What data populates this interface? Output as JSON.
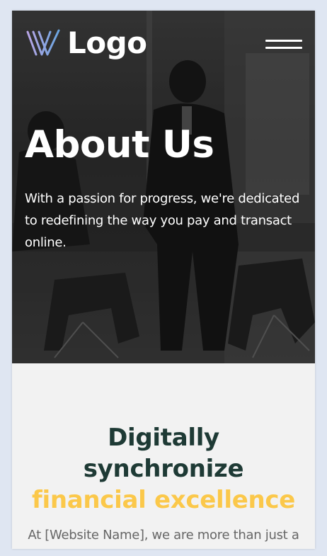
{
  "header": {
    "logo_text": "Logo",
    "logo_icon": "w-mark-icon",
    "menu_icon": "hamburger-menu-icon"
  },
  "hero": {
    "title": "About Us",
    "description": "With a passion for progress, we're dedicated to redefining the way you pay and transact online."
  },
  "intro": {
    "heading_line1": "Digitally",
    "heading_line2": "synchronize",
    "heading_accent": "financial excellence",
    "text": "At [Website Name], we are more than just a"
  },
  "colors": {
    "page_bg": "#dfe6f2",
    "section_bg": "#f2f2f2",
    "heading_dark": "#1e3a35",
    "accent": "#fbc84a",
    "body_text": "#666666",
    "logo_gradient_start": "#b9a6e6",
    "logo_gradient_end": "#6aa5e0"
  }
}
